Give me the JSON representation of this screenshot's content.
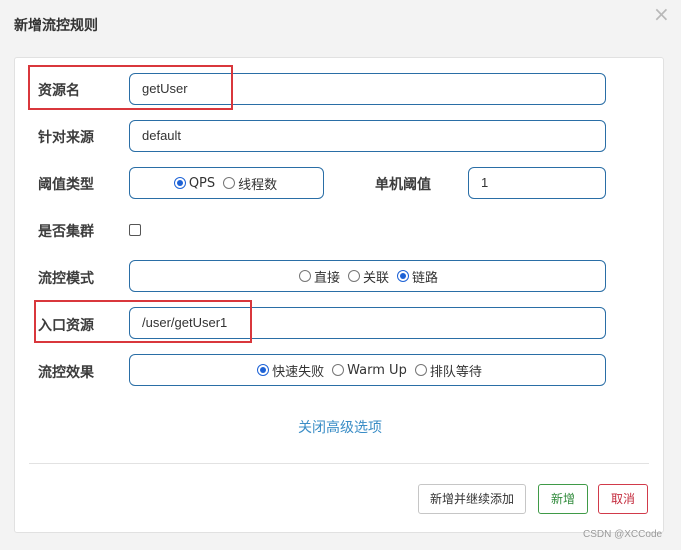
{
  "dialog": {
    "title": "新增流控规则",
    "close_icon": "×"
  },
  "form": {
    "resource_name": {
      "label": "资源名",
      "value": "getUser"
    },
    "limit_app": {
      "label": "针对来源",
      "value": "default"
    },
    "threshold_type": {
      "label": "阈值类型",
      "options": [
        {
          "label": "QPS",
          "checked": true
        },
        {
          "label": "线程数",
          "checked": false
        }
      ]
    },
    "single_threshold": {
      "label": "单机阈值",
      "value": "1"
    },
    "cluster": {
      "label": "是否集群",
      "checked": false
    },
    "flow_mode": {
      "label": "流控模式",
      "options": [
        {
          "label": "直接",
          "checked": false
        },
        {
          "label": "关联",
          "checked": false
        },
        {
          "label": "链路",
          "checked": true
        }
      ]
    },
    "entry_resource": {
      "label": "入口资源",
      "value": "/user/getUser1"
    },
    "flow_effect": {
      "label": "流控效果",
      "options": [
        {
          "label": "快速失败",
          "checked": true
        },
        {
          "label": "Warm Up",
          "checked": false
        },
        {
          "label": "排队等待",
          "checked": false
        }
      ]
    },
    "advanced_toggle": "关闭高级选项"
  },
  "footer": {
    "add_continue": "新增并继续添加",
    "add": "新增",
    "cancel": "取消"
  },
  "watermark": "CSDN @XCCode",
  "colors": {
    "input_border": "#2a6ea6",
    "highlight": "#d9373c",
    "link": "#3a8dc6",
    "add_button": "#2f8a3a",
    "cancel_button": "#c42c3e"
  }
}
